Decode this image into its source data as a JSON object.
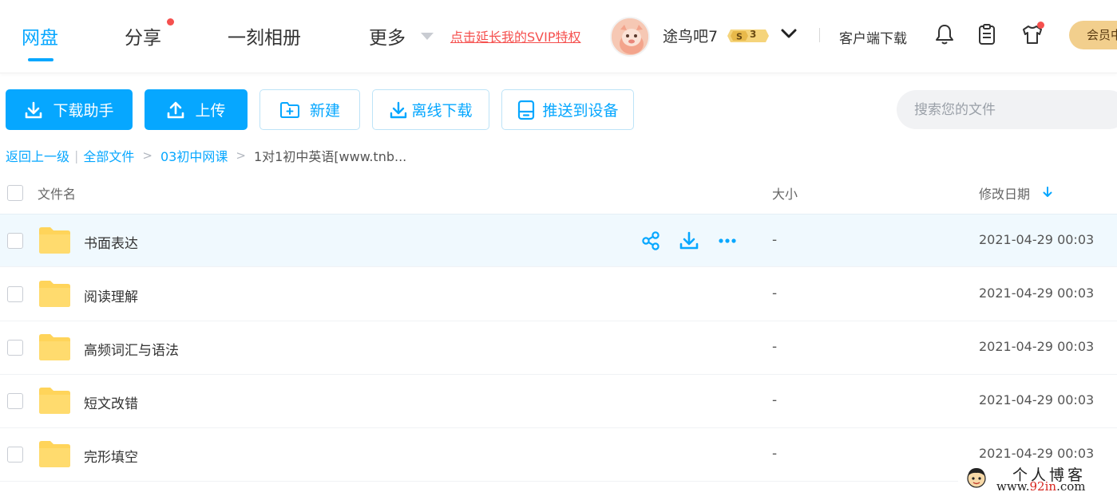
{
  "nav": {
    "tabs": [
      {
        "label": "网盘",
        "active": true
      },
      {
        "label": "分享",
        "badge_dot": true
      },
      {
        "label": "一刻相册"
      },
      {
        "label": "更多",
        "has_dropdown": true
      }
    ],
    "svip_link": "点击延长我的SVIP特权",
    "user": {
      "name": "途鸟吧7",
      "vip_level": "3",
      "vip_badge_letter": "S"
    },
    "client_download": "客户端下载",
    "member_button": "会员中心",
    "icons": [
      "bell-icon",
      "clipboard-icon",
      "tshirt-icon"
    ]
  },
  "toolbar": {
    "download_helper": "下载助手",
    "upload": "上传",
    "new": "新建",
    "offline_download": "离线下载",
    "push_to_device": "推送到设备",
    "search_placeholder": "搜索您的文件"
  },
  "breadcrumb": {
    "back": "返回上一级",
    "separator": "|",
    "items": [
      "全部文件",
      "03初中网课"
    ],
    "current": "1对1初中英语[www.tnb..."
  },
  "table": {
    "columns": {
      "name": "文件名",
      "size": "大小",
      "modified": "修改日期"
    },
    "sort": {
      "column": "modified",
      "direction": "desc"
    },
    "rows": [
      {
        "name": "书面表达",
        "size": "-",
        "modified": "2021-04-29 00:03",
        "hovered": true
      },
      {
        "name": "阅读理解",
        "size": "-",
        "modified": "2021-04-29 00:03"
      },
      {
        "name": "高频词汇与语法",
        "size": "-",
        "modified": "2021-04-29 00:03"
      },
      {
        "name": "短文改错",
        "size": "-",
        "modified": "2021-04-29 00:03"
      },
      {
        "name": "完形填空",
        "size": "-",
        "modified": "2021-04-29 00:03"
      }
    ],
    "row_actions": [
      "share-icon",
      "download-icon",
      "more-icon"
    ]
  },
  "watermark": {
    "title": "个人博客",
    "url_prefix": "www.",
    "url_highlight": "92in",
    "url_suffix": ".com"
  },
  "colors": {
    "accent": "#06a7ff",
    "svip_red": "#f5504e",
    "folder_yellow": "#ffd45a",
    "member_gold": "#f2cf8d"
  }
}
